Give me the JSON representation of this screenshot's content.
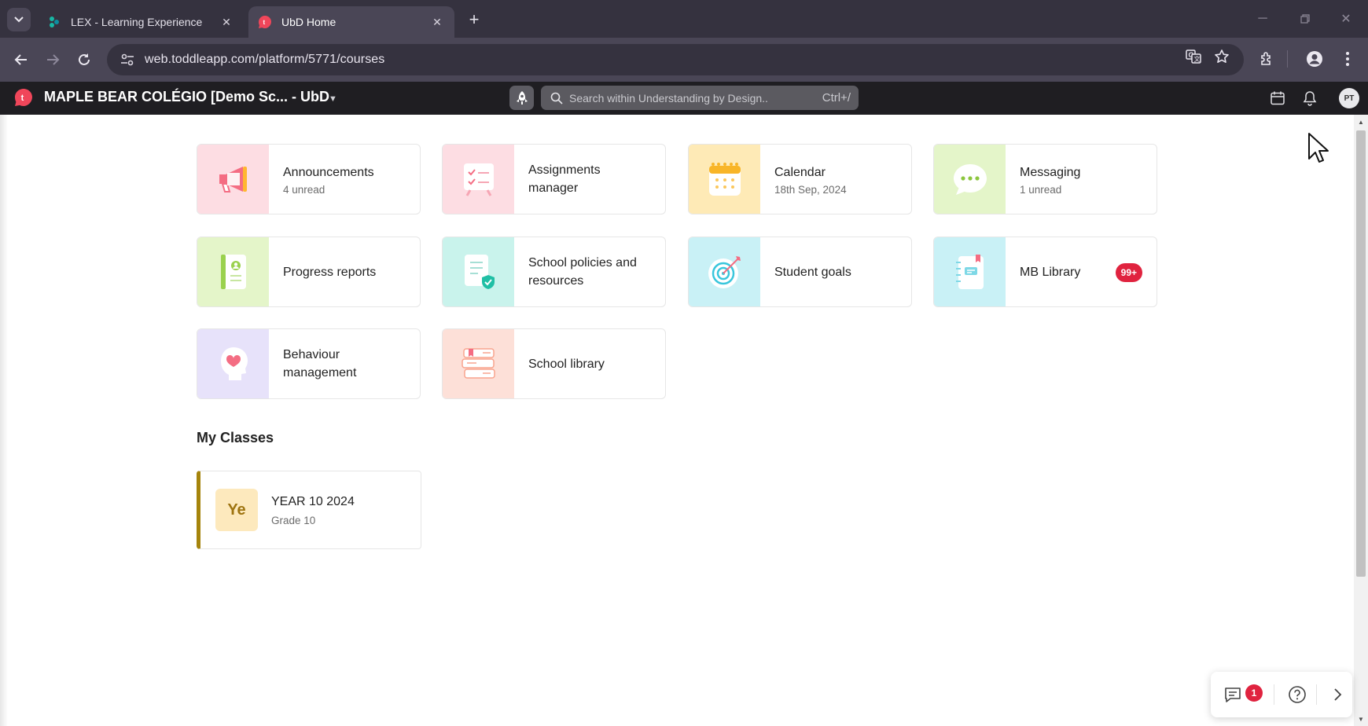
{
  "browser": {
    "tabs": [
      {
        "title": "LEX - Learning Experience",
        "active": false,
        "favicon": "lex-logo-icon"
      },
      {
        "title": "UbD Home",
        "active": true,
        "favicon": "toddle-logo-icon"
      }
    ],
    "url": "web.toddleapp.com/platform/5771/courses",
    "colors": {
      "titlebar": "#35323f",
      "toolbar": "#4a4656"
    }
  },
  "app": {
    "title": "MAPLE BEAR COLÉGIO [Demo Sc... - UbD",
    "search_placeholder": "Search within Understanding by Design..",
    "search_shortcut": "Ctrl+/",
    "avatar_initials": "PT",
    "brand_color": "#f0465a"
  },
  "tiles": [
    {
      "title": "Announcements",
      "subtitle": "4 unread",
      "icon": "megaphone-icon",
      "bg": "#fddde3"
    },
    {
      "title": "Assignments manager",
      "subtitle": "",
      "icon": "checklist-board-icon",
      "bg": "#fddde3"
    },
    {
      "title": "Calendar",
      "subtitle": "18th Sep, 2024",
      "icon": "calendar-icon",
      "bg": "#feeab6"
    },
    {
      "title": "Messaging",
      "subtitle": "1 unread",
      "icon": "chat-bubble-icon",
      "bg": "#e4f5c9"
    },
    {
      "title": "Progress reports",
      "subtitle": "",
      "icon": "report-book-icon",
      "bg": "#e4f5c9"
    },
    {
      "title": "School policies and resources",
      "subtitle": "",
      "icon": "policy-document-icon",
      "bg": "#c9f3ec"
    },
    {
      "title": "Student goals",
      "subtitle": "",
      "icon": "target-icon",
      "bg": "#c9f1f6"
    },
    {
      "title": "MB Library",
      "subtitle": "",
      "icon": "notebook-icon",
      "bg": "#c9f1f6",
      "badge": "99+"
    },
    {
      "title": "Behaviour management",
      "subtitle": "",
      "icon": "head-heart-icon",
      "bg": "#e7e2fa"
    },
    {
      "title": "School library",
      "subtitle": "",
      "icon": "books-stack-icon",
      "bg": "#fde0d8"
    }
  ],
  "my_classes": {
    "heading": "My Classes",
    "classes": [
      {
        "initials": "Ye",
        "name": "YEAR 10 2024",
        "grade": "Grade 10",
        "accent": "#a5840c"
      }
    ]
  },
  "help_widget": {
    "chat_badge": "1"
  }
}
